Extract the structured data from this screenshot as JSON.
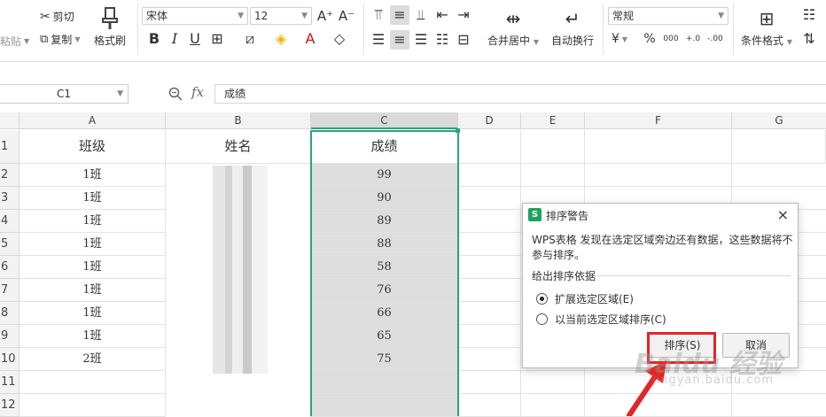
{
  "ribbon": {
    "paste": "粘贴",
    "cut": "剪切",
    "copy": "复制",
    "format_painter": "格式刷",
    "font_name": "宋体",
    "font_size": "12",
    "merge_center": "合并居中",
    "wrap_text": "自动换行",
    "number_format": "常规",
    "cond_format": "条件格式",
    "currency_symbol": "¥",
    "percent_symbol": "%",
    "thousands": "000",
    "inc_decimal": "+.0",
    "dec_decimal": "-.00"
  },
  "formula_bar": {
    "name_box": "C1",
    "fx": "fx",
    "content": "成绩"
  },
  "grid": {
    "columns": [
      "A",
      "B",
      "C",
      "D",
      "E",
      "F",
      "G"
    ],
    "row_numbers": [
      "1",
      "2",
      "3",
      "4",
      "5",
      "6",
      "7",
      "8",
      "9",
      "10",
      "11",
      "12"
    ],
    "headers": {
      "A": "班级",
      "B": "姓名",
      "C": "成绩"
    },
    "class_values": [
      "1班",
      "1班",
      "1班",
      "1班",
      "1班",
      "1班",
      "1班",
      "1班",
      "2班"
    ],
    "score_values": [
      "99",
      "90",
      "89",
      "88",
      "58",
      "76",
      "66",
      "65",
      "75"
    ]
  },
  "dialog": {
    "title": "排序警告",
    "close": "×",
    "message": "WPS表格 发现在选定区域旁边还有数据，这些数据将不参与排序。",
    "legend": "给出排序依据",
    "option_expand": "扩展选定区域(E)",
    "option_current": "以当前选定区域排序(C)",
    "sort_button": "排序(S)",
    "cancel_button": "取消"
  },
  "watermark": {
    "logo": "Baidu 经验",
    "url": "jingyan.baidu.com"
  },
  "colors": {
    "accent": "#2aa57a",
    "highlight": "#e52424",
    "selection": "#dedede"
  }
}
